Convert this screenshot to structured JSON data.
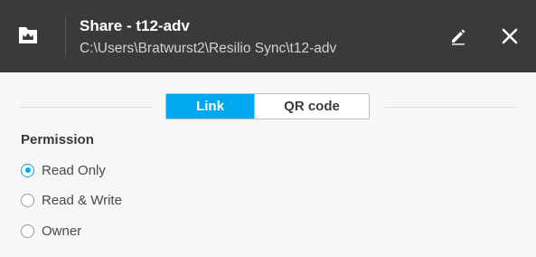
{
  "header": {
    "title": "Share - t12-adv",
    "path": "C:\\Users\\Bratwurst2\\Resilio Sync\\t12-adv",
    "folder_icon": "shared-folder-icon",
    "edit_icon": "pencil-icon",
    "close_icon": "close-icon"
  },
  "tabs": [
    {
      "label": "Link",
      "active": true
    },
    {
      "label": "QR code",
      "active": false
    }
  ],
  "permission": {
    "label": "Permission",
    "options": [
      {
        "label": "Read Only",
        "checked": true
      },
      {
        "label": "Read & Write",
        "checked": false
      },
      {
        "label": "Owner",
        "checked": false
      }
    ]
  },
  "colors": {
    "header_bg": "#3a3a3a",
    "accent": "#00a8ef",
    "body_bg": "#f7f7f7"
  }
}
